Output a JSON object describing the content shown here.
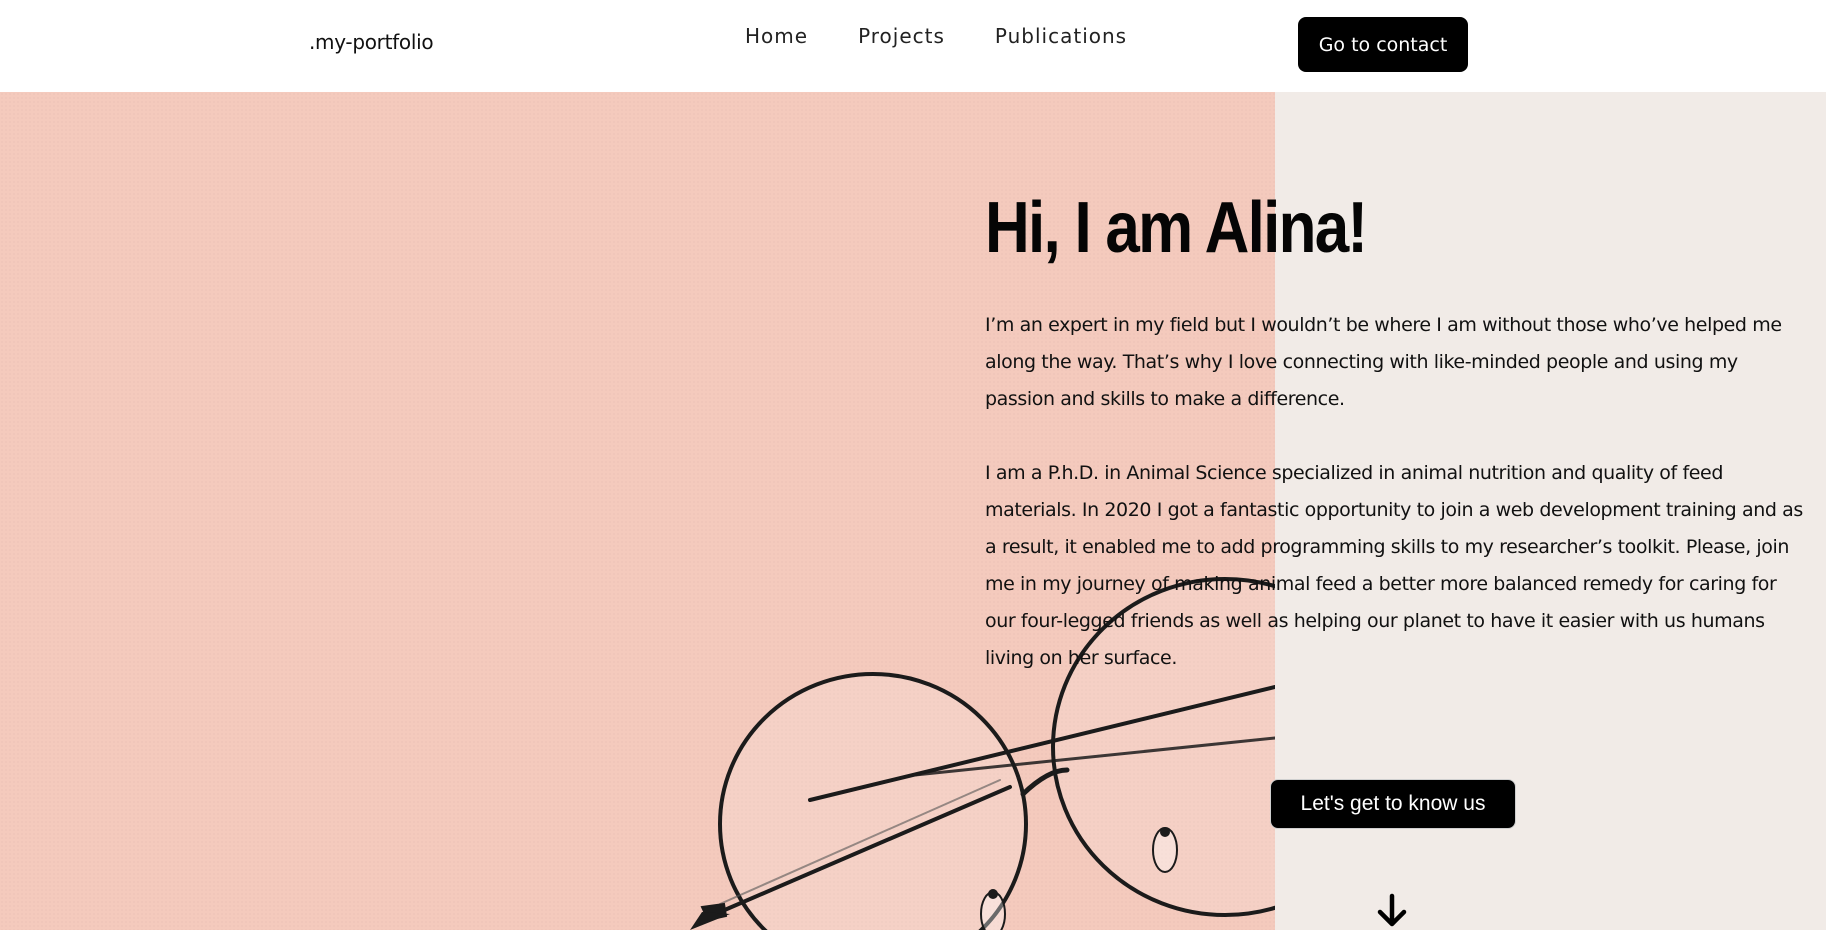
{
  "header": {
    "brand": ".my-portfolio",
    "nav": [
      {
        "label": "Home"
      },
      {
        "label": "Projects"
      },
      {
        "label": "Publications"
      }
    ],
    "contact_button": "Go to contact"
  },
  "hero": {
    "title": "Hi, I am Alina!",
    "paragraphs": [
      "I’m an expert in my field but I wouldn’t be where I am without those who’ve helped me along the way. That’s why I love connecting with like-minded people and using my passion and skills to make a difference.",
      "I am a P.h.D. in Animal Science specialized in animal nutrition and quality of feed materials. In 2020 I got a fantastic opportunity to join a web development training and as a result, it enabled me to add programming skills to my researcher’s toolkit. Please, join me in my journey of making animal feed a better more balanced remedy for caring for our four-legged friends as well as helping our planet to have it easier with us humans living on her surface."
    ],
    "cta_button": "Let's get to know us",
    "scroll_icon": "arrow-down-icon",
    "image_icon": "round-glasses-illustration"
  },
  "colors": {
    "hero_left_bg": "#f4cabd",
    "hero_right_bg": "#f1ebe7",
    "button_bg": "#000000",
    "button_text": "#ffffff"
  }
}
